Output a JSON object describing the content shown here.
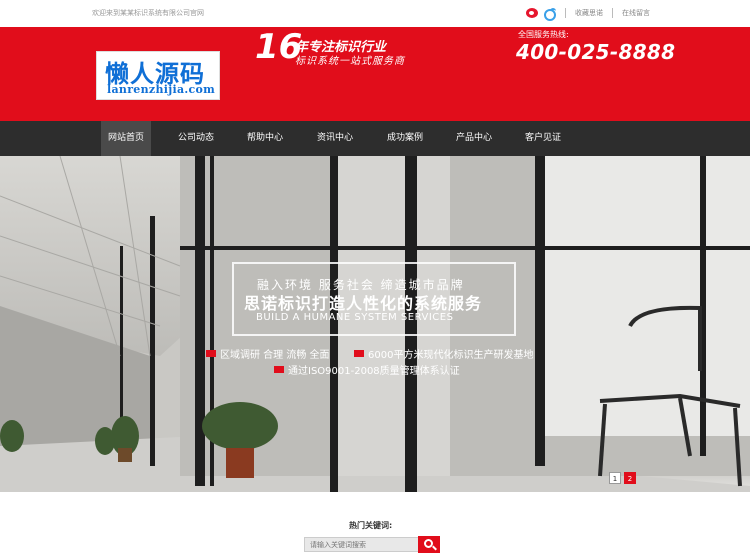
{
  "topbar": {
    "welcome": "欢迎来到某某标识系统有限公司官网",
    "links": [
      "收藏思诺",
      "在线留言"
    ]
  },
  "header": {
    "logo_cn": "懒人源码",
    "logo_en": "lanrenzhijia.com",
    "slogan_number": "16",
    "slogan_line1": "年专注标识行业",
    "slogan_line2": "标识系统一站式服务商",
    "hotline_label": "全国服务热线:",
    "hotline": "400-025-8888"
  },
  "nav": {
    "items": [
      "网站首页",
      "公司动态",
      "帮助中心",
      "资讯中心",
      "成功案例",
      "产品中心",
      "客户见证"
    ],
    "active_index": 0
  },
  "banner": {
    "line1": "融入环境  服务社会  缔造城市品牌",
    "line2": "思诺标识打造人性化的系统服务",
    "line3": "BUILD A HUMANE SYSTEM SERVICES",
    "features": [
      "区域调研 合理 流畅 全面",
      "6000平方米现代化标识生产研发基地",
      "通过ISO9001-2008质量管理体系认证"
    ],
    "pages": [
      "1",
      "2"
    ],
    "current_page": "2"
  },
  "search": {
    "title": "热门关键词:",
    "placeholder": "请输入关键词搜索"
  },
  "colors": {
    "brand_red": "#e10d1b",
    "nav_bg": "#2d2d2d",
    "logo_blue": "#0f6fd6"
  }
}
